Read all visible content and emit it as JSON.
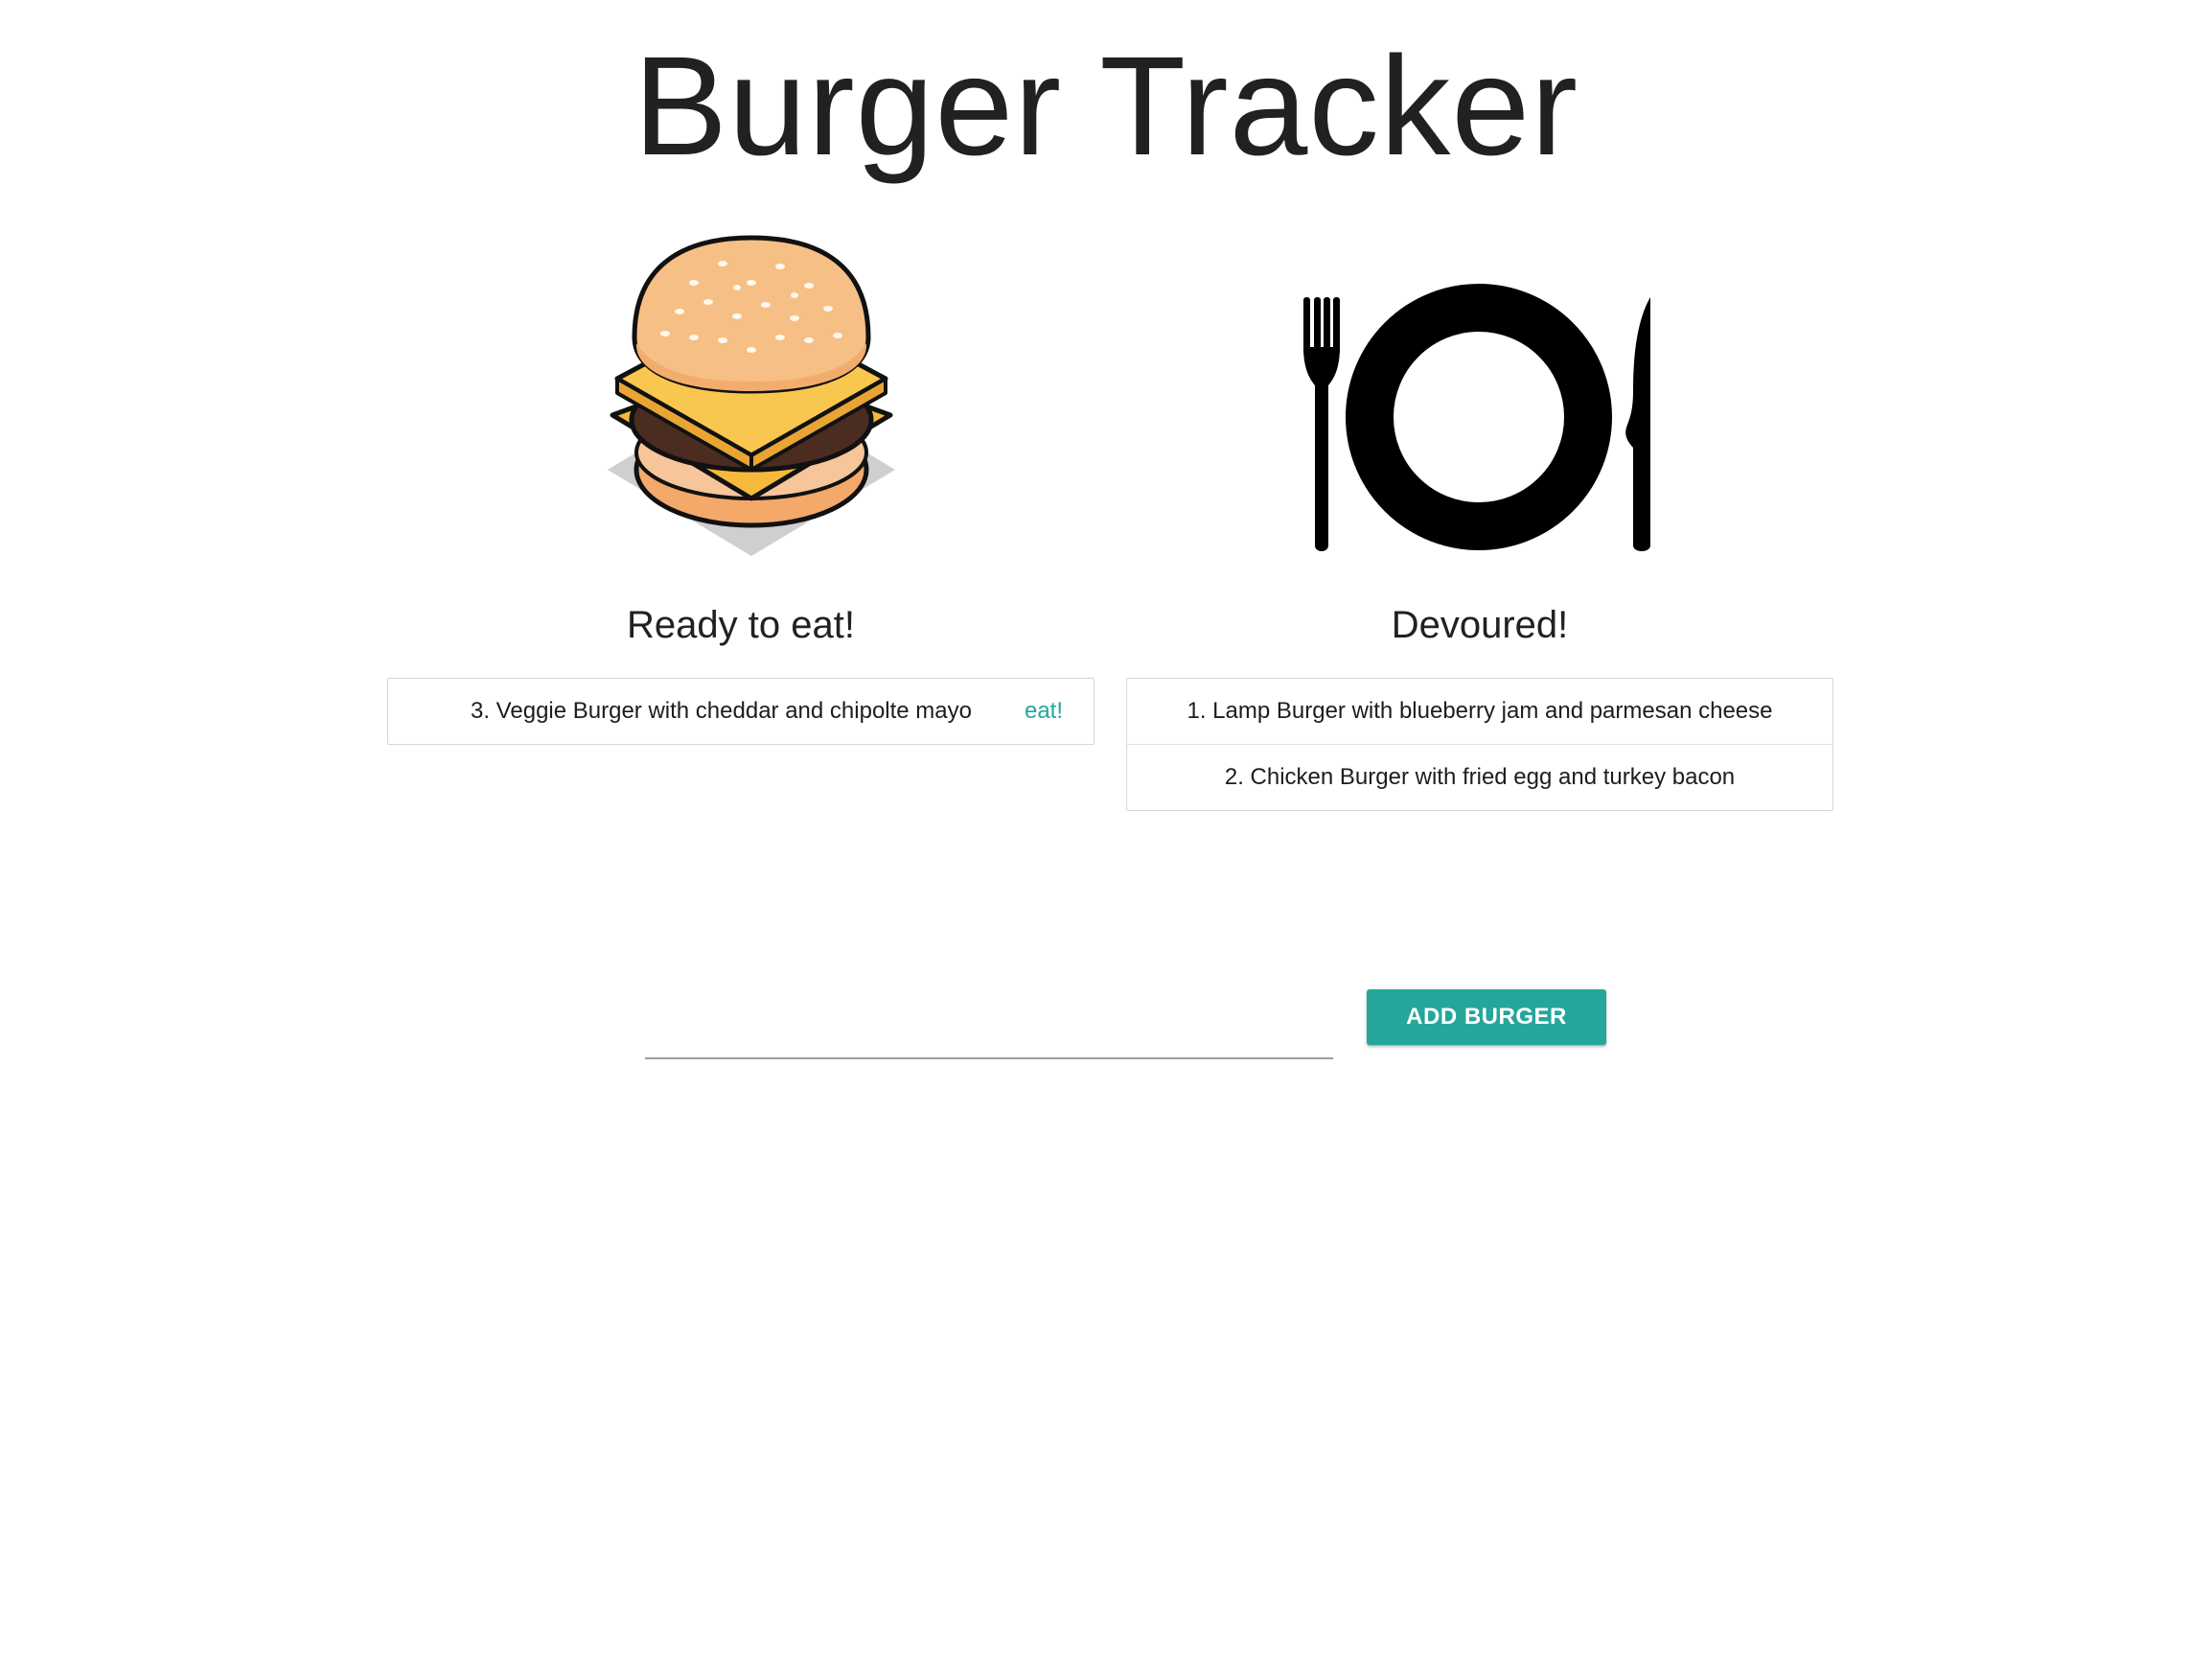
{
  "app": {
    "title": "Burger Tracker"
  },
  "ready": {
    "heading": "Ready to eat!",
    "image_icon": "burger-icon",
    "items": [
      {
        "label": "3. Veggie Burger with cheddar and chipolte mayo",
        "action": "eat!"
      }
    ]
  },
  "devoured": {
    "heading": "Devoured!",
    "image_icon": "plate-fork-knife-icon",
    "items": [
      {
        "label": "1. Lamp Burger with blueberry jam and parmesan cheese"
      },
      {
        "label": "2. Chicken Burger with fried egg and turkey bacon"
      }
    ]
  },
  "form": {
    "input_value": "",
    "input_placeholder": "",
    "button_label": "ADD BURGER"
  },
  "colors": {
    "accent": "#26a69a",
    "text": "#212121",
    "border": "#d6d6d6"
  }
}
